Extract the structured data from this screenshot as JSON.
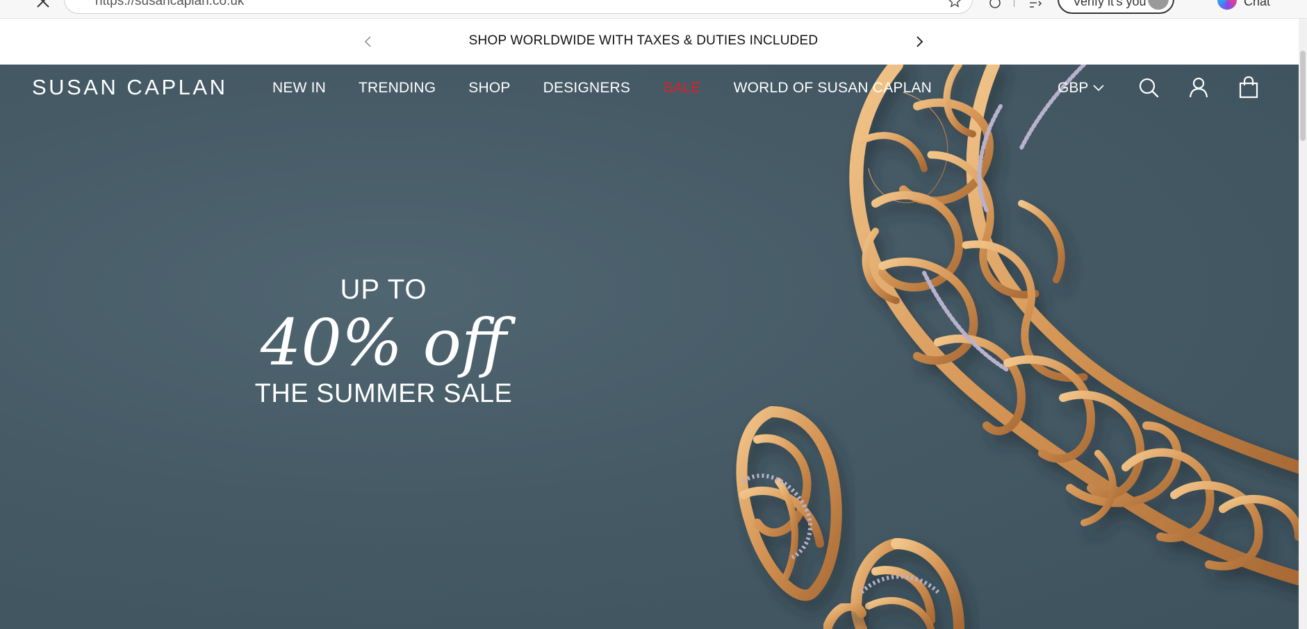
{
  "browser": {
    "url": "https://susancaplan.co.uk",
    "verify_label": "Verify it's you",
    "chat_label": "Chat"
  },
  "announcement": {
    "message": "SHOP WORLDWIDE WITH TAXES & DUTIES INCLUDED"
  },
  "header": {
    "logo": "SUSAN CAPLAN",
    "nav": [
      {
        "label": "NEW IN"
      },
      {
        "label": "TRENDING"
      },
      {
        "label": "SHOP"
      },
      {
        "label": "DESIGNERS"
      },
      {
        "label": "SALE"
      },
      {
        "label": "WORLD OF SUSAN CAPLAN"
      }
    ],
    "currency": "GBP"
  },
  "hero": {
    "line1": "UP TO",
    "line2": "40% off",
    "line3": "THE SUMMER SALE"
  },
  "colors": {
    "hero_bg": "#455a65",
    "sale_red": "#e21e26",
    "gold": "#d9a062"
  }
}
